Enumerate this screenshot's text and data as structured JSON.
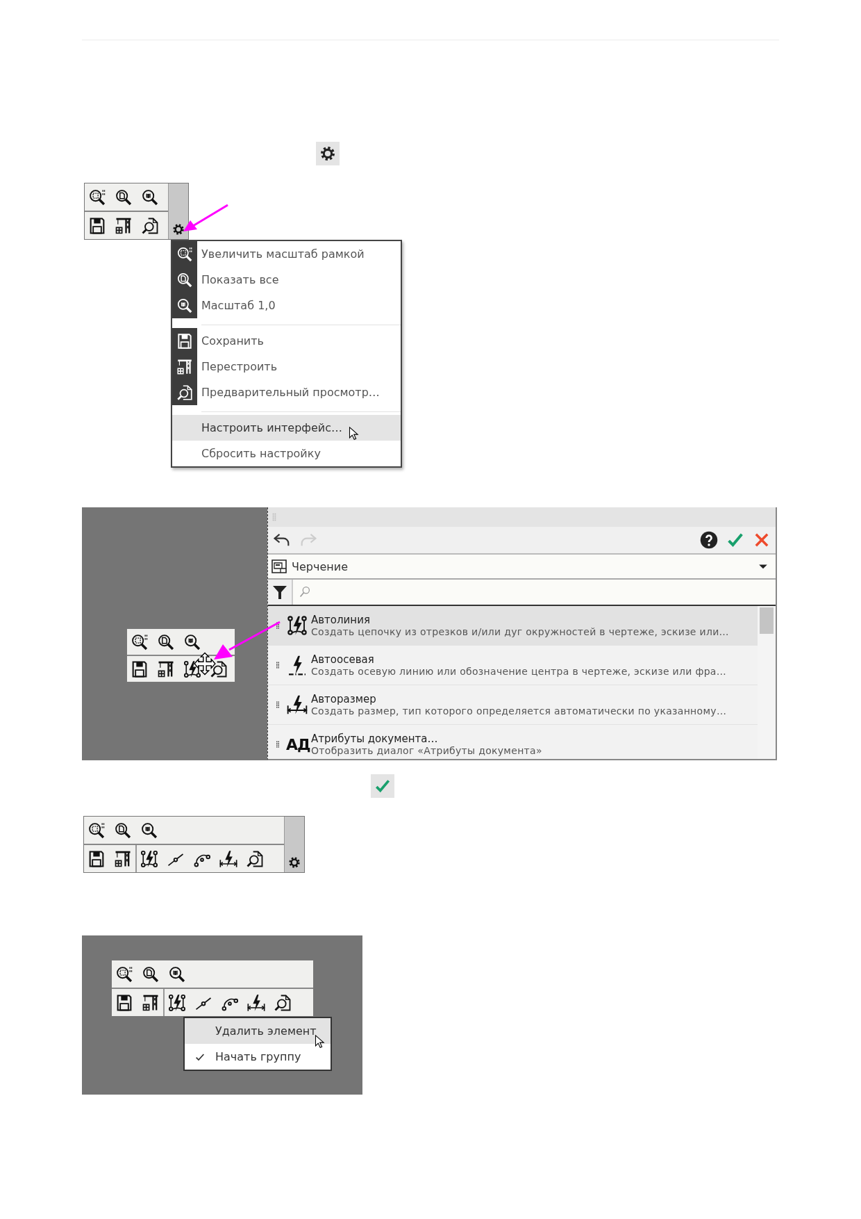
{
  "settings_menu": {
    "groups": [
      {
        "items": [
          {
            "label": "Увеличить масштаб рамкой",
            "highlighted": false
          },
          {
            "label": "Показать все",
            "highlighted": false
          },
          {
            "label": "Масштаб 1,0",
            "highlighted": false
          }
        ]
      },
      {
        "items": [
          {
            "label": "Сохранить",
            "highlighted": false
          },
          {
            "label": "Перестроить",
            "highlighted": false
          },
          {
            "label": "Предварительный просмотр…",
            "highlighted": false
          }
        ]
      },
      {
        "items": [
          {
            "label": "Настроить интерфейс…",
            "highlighted": true
          },
          {
            "label": "Сбросить настройку",
            "highlighted": false
          }
        ]
      }
    ]
  },
  "commands_panel": {
    "undo_disabled": false,
    "redo_disabled": true,
    "category": "Черчение",
    "items": [
      {
        "title": "Автолиния",
        "description": "Создать цепочку из отрезков и/или дуг окружностей в чертеже, эскизе или…",
        "selected": true
      },
      {
        "title": "Автоосевая",
        "description": "Создать осевую линию или обозначение центра в чертеже, эскизе или фра…",
        "selected": false
      },
      {
        "title": "Авторазмер",
        "description": "Создать размер, тип которого определяется автоматически по указанному…",
        "selected": false
      },
      {
        "title": "Атрибуты документа…",
        "description": "Отобразить диалог «Атрибуты документа»",
        "selected": false,
        "icon_text": "АД"
      }
    ]
  },
  "context_menu": {
    "items": [
      {
        "label": "Удалить элемент",
        "highlighted": true,
        "checked": false
      },
      {
        "label": "Начать группу",
        "highlighted": false,
        "checked": true
      }
    ]
  }
}
